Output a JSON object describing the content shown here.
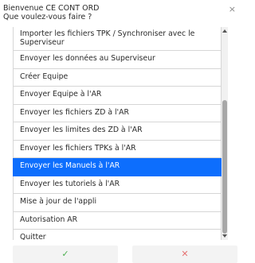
{
  "dialog": {
    "title": "Bienvenue CE CONT ORD",
    "subtitle": "Que voulez-vous faire ?",
    "close_glyph": "×"
  },
  "menu": {
    "items": [
      {
        "label": "Importer les fichiers TPK / Synchroniser avec le Superviseur",
        "selected": false
      },
      {
        "label": "Envoyer les données au Superviseur",
        "selected": false
      },
      {
        "label": "Créer Equipe",
        "selected": false
      },
      {
        "label": "Envoyer Equipe à l'AR",
        "selected": false
      },
      {
        "label": "Envoyer les fichiers ZD à l'AR",
        "selected": false
      },
      {
        "label": "Envoyer les limites des ZD à l'AR",
        "selected": false
      },
      {
        "label": "Envoyer les fichiers TPKs à l'AR",
        "selected": false
      },
      {
        "label": "Envoyer les Manuels à l'AR",
        "selected": true
      },
      {
        "label": "Envoyer les tutoriels à l'AR",
        "selected": false
      },
      {
        "label": "Mise à jour de l'appli",
        "selected": false
      },
      {
        "label": "Autorisation AR",
        "selected": false
      },
      {
        "label": "Quitter",
        "selected": false
      }
    ]
  },
  "buttons": {
    "ok_glyph": "✓",
    "cancel_glyph": "✕"
  },
  "colors": {
    "selected_bg": "#0d6efd",
    "ok": "#4caf50",
    "cancel": "#e57373"
  }
}
